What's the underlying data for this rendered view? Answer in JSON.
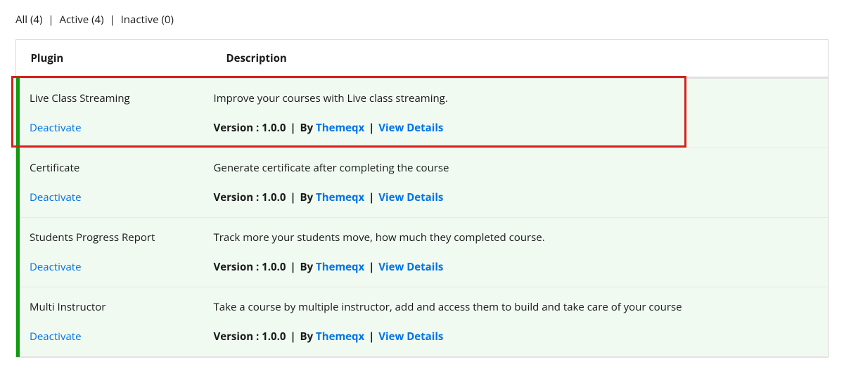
{
  "filters": {
    "all": {
      "label": "All",
      "count": "(4)"
    },
    "active": {
      "label": "Active",
      "count": "(4)"
    },
    "inactive": {
      "label": "Inactive",
      "count": "(0)"
    }
  },
  "headers": {
    "plugin": "Plugin",
    "description": "Description"
  },
  "meta_labels": {
    "version_prefix": "Version : ",
    "by_prefix": "By ",
    "view_details": "View Details"
  },
  "plugins": [
    {
      "name": "Live Class Streaming",
      "action": "Deactivate",
      "description": "Improve your courses with Live class streaming.",
      "version": "1.0.0",
      "author": "Themeqx"
    },
    {
      "name": "Certificate",
      "action": "Deactivate",
      "description": "Generate certificate after completing the course",
      "version": "1.0.0",
      "author": "Themeqx"
    },
    {
      "name": "Students Progress Report",
      "action": "Deactivate",
      "description": "Track more your students move, how much they completed course.",
      "version": "1.0.0",
      "author": "Themeqx"
    },
    {
      "name": "Multi Instructor",
      "action": "Deactivate",
      "description": "Take a course by multiple instructor, add and access them to build and take care of your course",
      "version": "1.0.0",
      "author": "Themeqx"
    }
  ]
}
